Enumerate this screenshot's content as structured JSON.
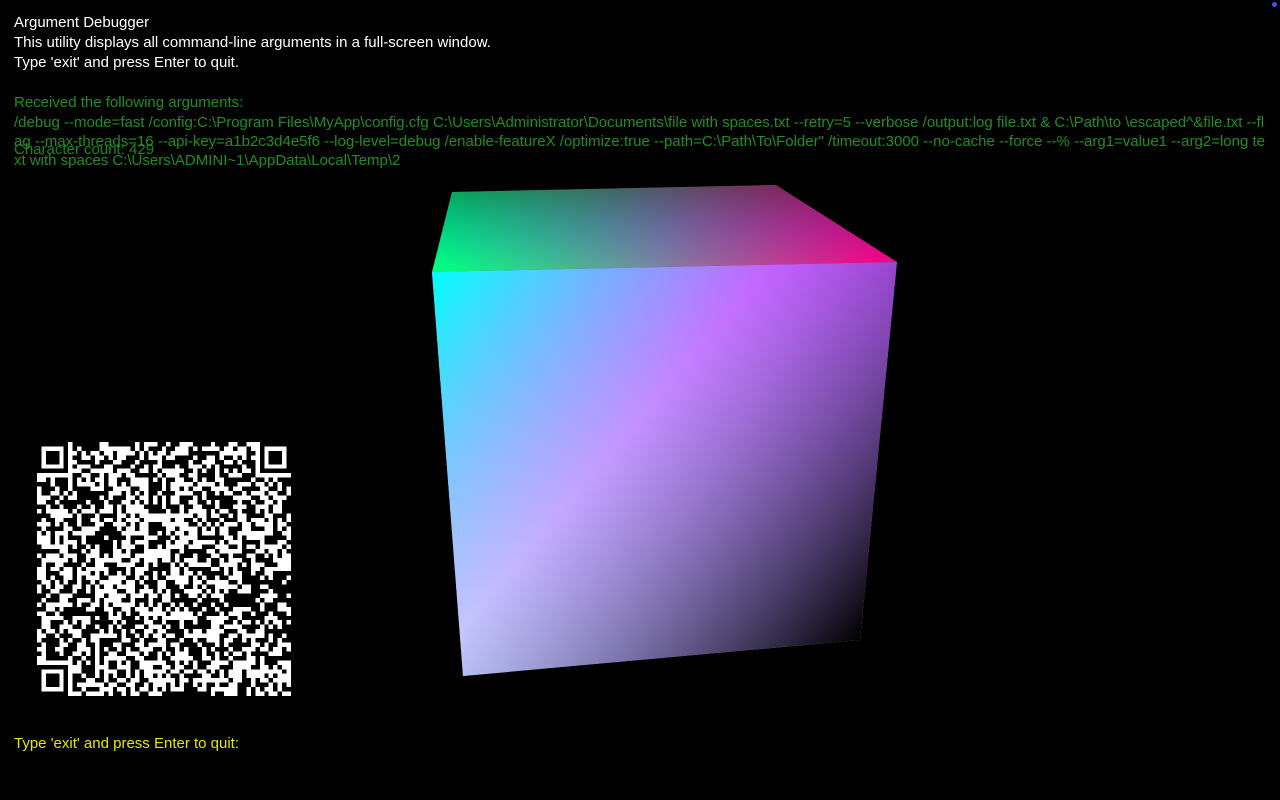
{
  "header": {
    "title": "Argument Debugger",
    "description": "This utility displays all command-line arguments in a full-screen window.",
    "instructions": "Type 'exit' and press Enter to quit."
  },
  "arguments": {
    "label": "Received the following arguments:",
    "text": "/debug --mode=fast /config:C:\\Program Files\\MyApp\\config.cfg C:\\Users\\Administrator\\Documents\\file with spaces.txt --retry=5 --verbose /output:log file.txt & C:\\Path\\to \\escaped^&file.txt --flag --max-threads=16 --api-key=a1b2c3d4e5f6 --log-level=debug /enable-featureX /optimize:true --path=C:\\Path\\To\\Folder\" /timeout:3000 --no-cache --force --% --arg1=value1 --arg2=long text with spaces C:\\Users\\ADMINI~1\\AppData\\Local\\Temp\\2",
    "character_count": "Character count: 429"
  },
  "cube": {
    "name": "rgb-color-cube",
    "colors": {
      "white": "#ffffff",
      "black": "#000000",
      "cyan": "#00ffff",
      "magenta": "#ff00ff",
      "green": "#00ff00",
      "red": "#ff0000"
    }
  },
  "qr": {
    "name": "qr-code"
  },
  "prompt": {
    "label": "Type 'exit' and press Enter to quit:",
    "value": ""
  },
  "colors": {
    "background": "#000000",
    "header_text": "#ffffff",
    "arguments_text": "#1f8f1f",
    "prompt_text": "#e6e600"
  }
}
